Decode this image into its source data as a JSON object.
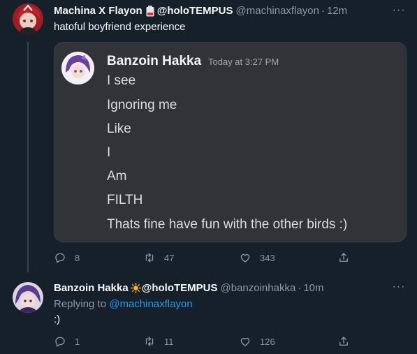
{
  "tweet1": {
    "display_name": "Machina X Flayon",
    "display_name_suffix": "@holoTEMPUS",
    "handle": "@machinaxflayon",
    "time": "12m",
    "text": "hatoful boyfriend experience",
    "embed": {
      "author": "Banzoin Hakka",
      "timestamp": "Today at 3:27 PM",
      "lines": [
        "I see",
        "Ignoring me",
        "Like",
        "I",
        "Am",
        "FILTH",
        "Thats fine have fun with the other birds :)"
      ]
    },
    "replies": "8",
    "retweets": "47",
    "likes": "343"
  },
  "tweet2": {
    "display_name": "Banzoin Hakka",
    "display_name_suffix": "@holoTEMPUS",
    "handle": "@banzoinhakka",
    "time": "10m",
    "replying_label": "Replying to",
    "replying_to": "@machinaxflayon",
    "text": ":)",
    "replies": "1",
    "retweets": "11",
    "likes": "126"
  },
  "colors": {
    "background": "#15202b",
    "accent": "#1d9bf0",
    "muted": "#8b98a5",
    "embed_bg": "#323339"
  }
}
